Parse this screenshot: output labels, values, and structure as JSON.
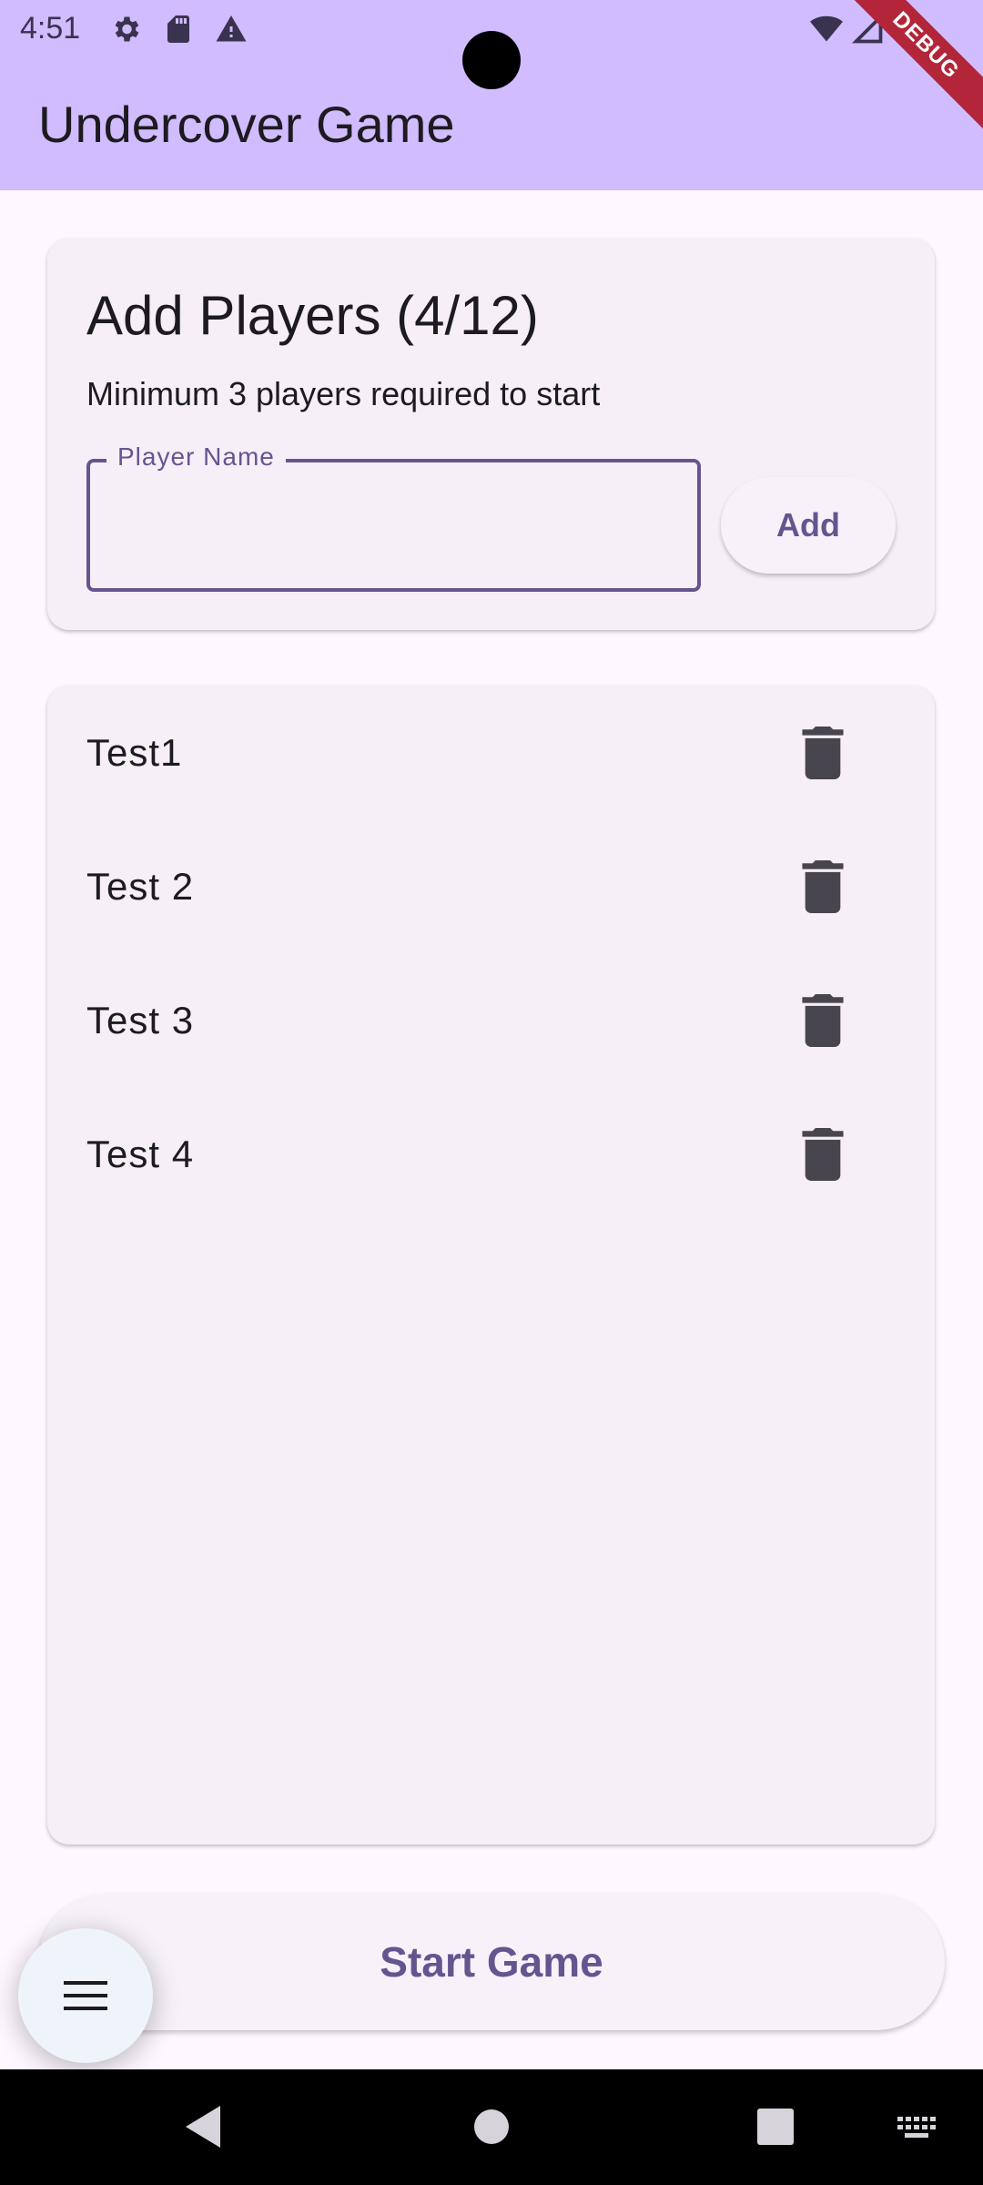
{
  "status_bar": {
    "time": "4:51",
    "icons": [
      "gear-icon",
      "sd-card-icon",
      "warning-icon",
      "wifi-icon",
      "signal-icon",
      "battery-icon"
    ],
    "debug_label": "DEBUG"
  },
  "app_bar": {
    "title": "Undercover Game",
    "background_color": "#d0bcff"
  },
  "add_players": {
    "title": "Add Players (4/12)",
    "subtitle": "Minimum 3 players required to start",
    "name_field": {
      "label": "Player Name",
      "value": ""
    },
    "add_label": "Add"
  },
  "players": [
    {
      "name": "Test1"
    },
    {
      "name": "Test 2"
    },
    {
      "name": "Test 3"
    },
    {
      "name": "Test 4"
    }
  ],
  "start_label": "Start Game",
  "accent_color": "#65558f",
  "fab_icon": "menu-icon",
  "nav_bar": {
    "buttons": [
      "back-icon",
      "home-icon",
      "recents-icon",
      "keyboard-icon"
    ]
  }
}
